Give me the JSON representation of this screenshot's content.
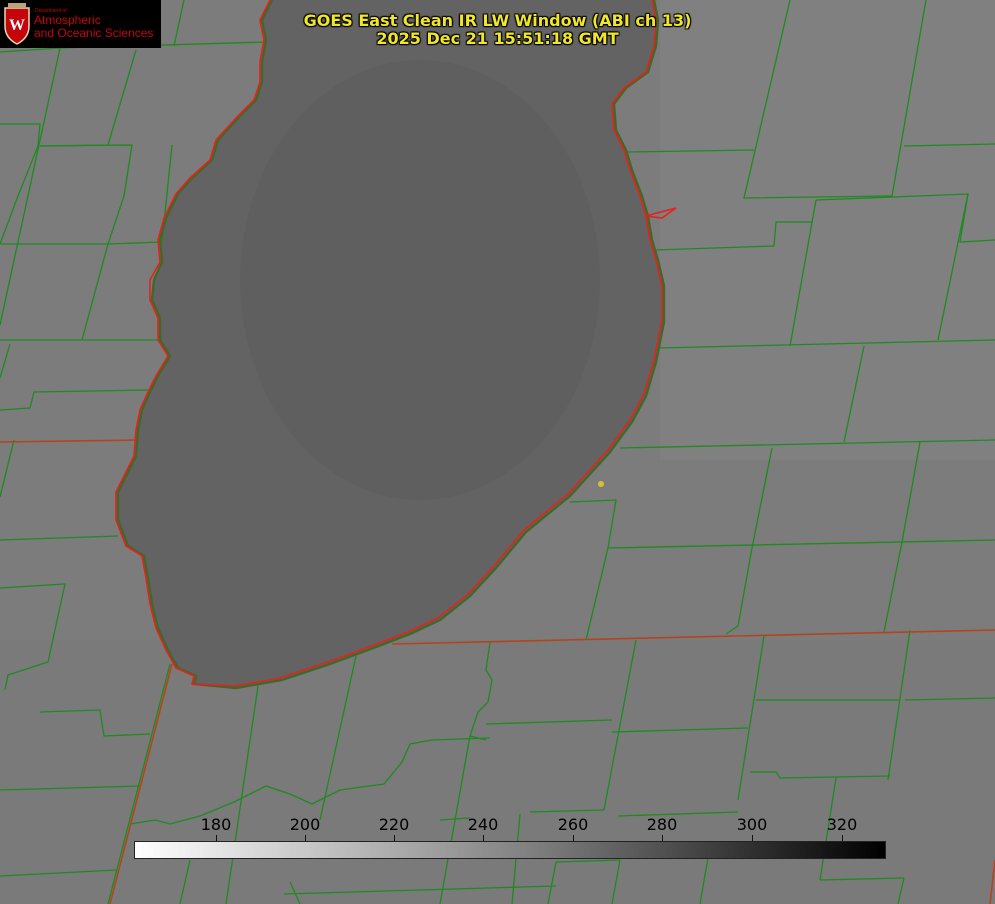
{
  "title_line1": "GOES East Clean IR LW Window (ABI ch 13)",
  "title_line2": "2025 Dec 21 15:51:18 GMT",
  "logo": {
    "dept": "Department of",
    "line1": "Atmospheric",
    "line2": "and Oceanic Sciences"
  },
  "colorbar": {
    "ticks": [
      "180",
      "200",
      "220",
      "240",
      "260",
      "280",
      "300",
      "320"
    ],
    "min_color": "#ffffff",
    "max_color": "#000000"
  },
  "colors": {
    "land": "#7c7c7c",
    "lake": "#626262",
    "county_lines": "#1f8a1f",
    "state_lines": "#c0391b",
    "shoreline": "#e8201a",
    "title_text": "#f0e62a",
    "marker": "#d4c42a"
  },
  "icons": {
    "logo": "uw-crest-icon",
    "marker": "location-dot-icon"
  }
}
